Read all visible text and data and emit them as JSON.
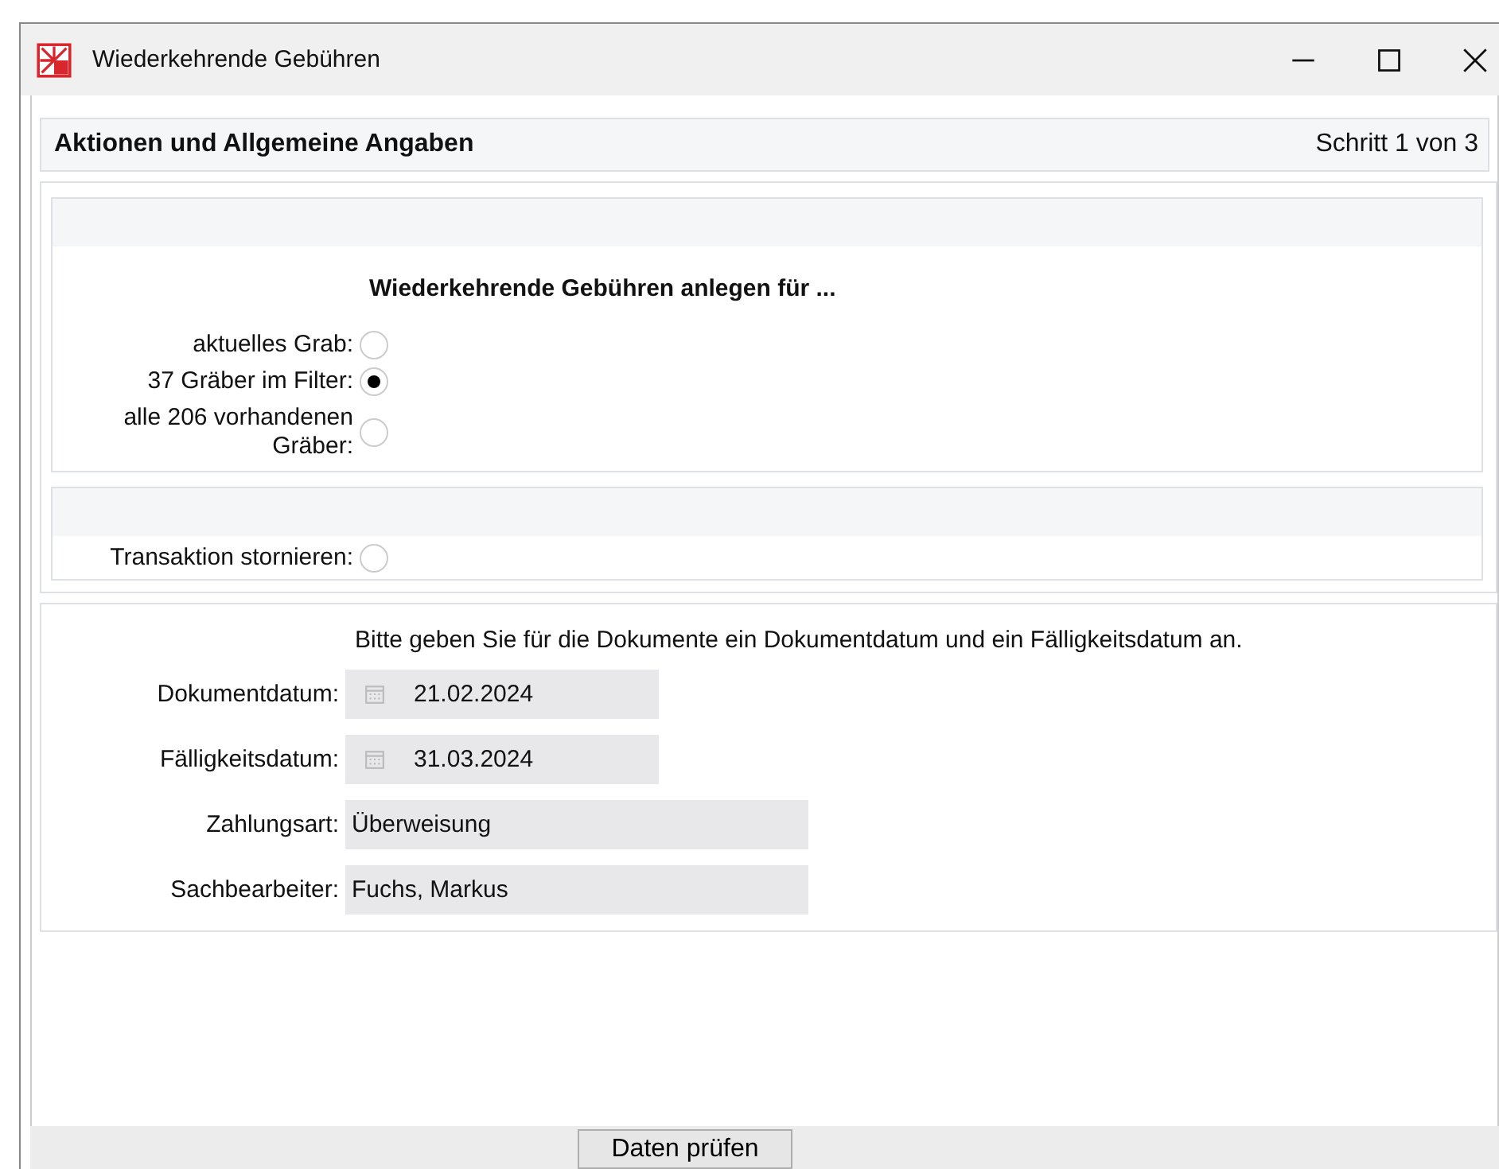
{
  "window": {
    "title": "Wiederkehrende Gebühren"
  },
  "header": {
    "title": "Aktionen und Allgemeine Angaben",
    "step": "Schritt 1 von 3"
  },
  "create_for": {
    "heading": "Wiederkehrende Gebühren anlegen für ...",
    "options": [
      {
        "label": "aktuelles Grab:",
        "selected": false
      },
      {
        "label": "37 Gräber im Filter:",
        "selected": true
      },
      {
        "label": "alle 206 vorhandenen Gräber:",
        "selected": false
      }
    ]
  },
  "cancel": {
    "label": "Transaktion stornieren:",
    "selected": false
  },
  "details": {
    "hint": "Bitte geben Sie für die Dokumente ein Dokumentdatum und ein Fälligkeitsdatum an.",
    "fields": [
      {
        "kind": "date",
        "label": "Dokumentdatum:",
        "value": "21.02.2024"
      },
      {
        "kind": "date",
        "label": "Fälligkeitsdatum:",
        "value": "31.03.2024"
      },
      {
        "kind": "text",
        "label": "Zahlungsart:",
        "value": "Überweisung"
      },
      {
        "kind": "text",
        "label": "Sachbearbeiter:",
        "value": "Fuchs, Markus"
      }
    ]
  },
  "buttons": [
    "Daten prüfen"
  ]
}
